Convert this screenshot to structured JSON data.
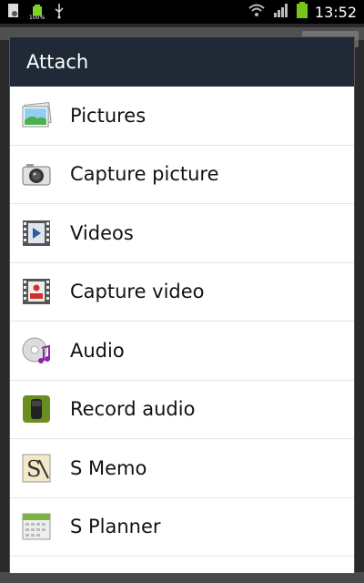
{
  "status_bar": {
    "time": "13:52",
    "battery_label": "100%",
    "icons": [
      "settings-file-icon",
      "battery-small-icon",
      "usb-icon",
      "wifi-icon",
      "signal-icon",
      "battery-icon"
    ]
  },
  "dialog": {
    "title": "Attach",
    "items": [
      {
        "label": "Pictures",
        "icon": "pictures-icon"
      },
      {
        "label": "Capture picture",
        "icon": "camera-icon"
      },
      {
        "label": "Videos",
        "icon": "video-icon"
      },
      {
        "label": "Capture video",
        "icon": "record-video-icon"
      },
      {
        "label": "Audio",
        "icon": "audio-icon"
      },
      {
        "label": "Record audio",
        "icon": "microphone-icon"
      },
      {
        "label": "S Memo",
        "icon": "s-memo-icon"
      },
      {
        "label": "S Planner",
        "icon": "calendar-icon"
      }
    ]
  },
  "colors": {
    "title_bar": "#1f2a36",
    "status_bar": "#000000",
    "accent_green": "#78c51a"
  }
}
